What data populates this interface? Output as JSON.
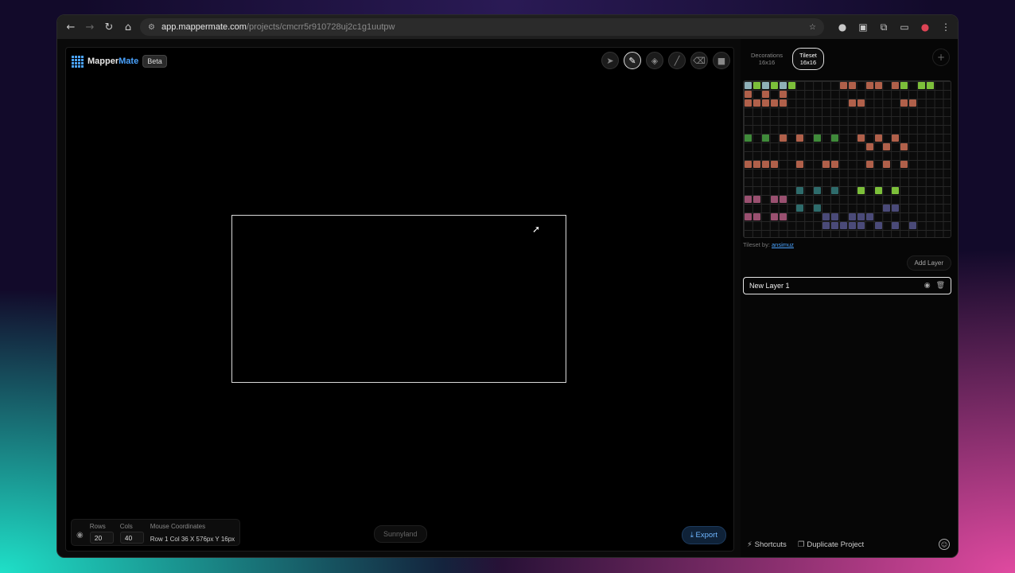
{
  "browser": {
    "url_host": "app.mappermate.com",
    "url_path": "/projects/cmcrr5r910728uj2c1g1uutpw",
    "icons": [
      "back-icon",
      "forward-icon",
      "reload-icon",
      "home-icon",
      "site-settings-icon",
      "bookmark-star-icon",
      "extension-icon",
      "menu-dots-icon"
    ]
  },
  "app": {
    "logo_name": "Mapper",
    "logo_accent": "Mate",
    "badge": "Beta",
    "accent_color": "#4aa3ff"
  },
  "tools": [
    {
      "name": "select-tool",
      "icon": "pointer-icon",
      "active": false
    },
    {
      "name": "brush-tool",
      "icon": "brush-icon",
      "active": true
    },
    {
      "name": "fill-tool",
      "icon": "paint-bucket-icon",
      "active": false
    },
    {
      "name": "line-tool",
      "icon": "line-icon",
      "active": false
    },
    {
      "name": "eraser-tool",
      "icon": "eraser-icon",
      "active": false
    },
    {
      "name": "rectangle-tool",
      "icon": "square-icon",
      "active": false
    }
  ],
  "status": {
    "rows_label": "Rows",
    "rows_value": "20",
    "cols_label": "Cols",
    "cols_value": "40",
    "mouse_label": "Mouse Coordinates",
    "mouse_value": "Row 1  Col 36  X 576px  Y 16px"
  },
  "tileset_name": "Sunnyland",
  "export_label": "Export",
  "sidebar": {
    "tabs": [
      {
        "title": "Decorations",
        "size": "16x16",
        "active": false
      },
      {
        "title": "Tileset",
        "size": "16x16",
        "active": true
      }
    ],
    "credit_prefix": "Tileset by:",
    "credit_author": "ansimuz",
    "add_layer_label": "Add Layer",
    "layers": [
      {
        "name": "New Layer 1"
      }
    ],
    "shortcuts_label": "Shortcuts",
    "duplicate_label": "Duplicate Project"
  }
}
